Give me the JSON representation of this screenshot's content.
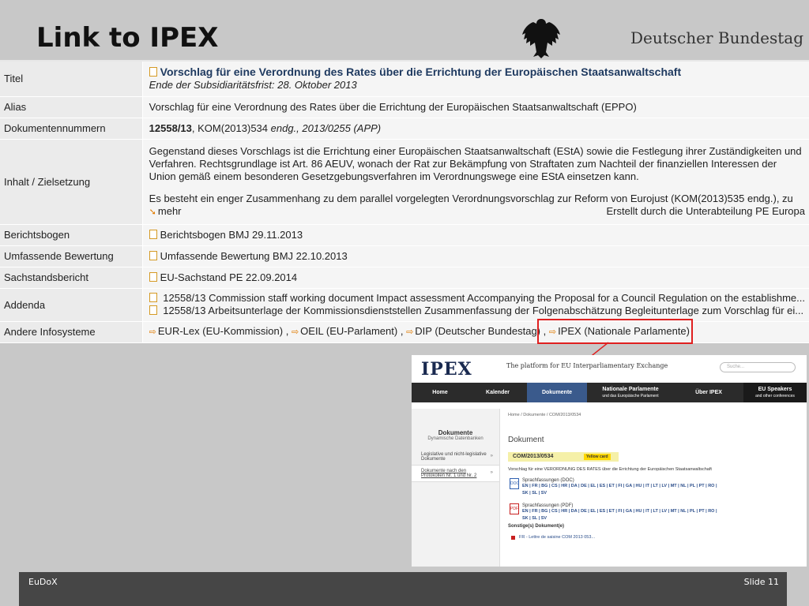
{
  "slide": {
    "title": "Link to IPEX",
    "org_name": "Deutscher Bundestag"
  },
  "rows": [
    {
      "label": "Titel",
      "title": "Vorschlag für eine Verordnung des Rates über die Errichtung der Europäischen Staatsanwaltschaft",
      "subtitle": "Ende der Subsidiaritätsfrist: 28. Oktober 2013"
    },
    {
      "label": "Alias",
      "value": "Vorschlag für eine Verordnung des Rates über die Errichtung der Europäischen Staatsanwaltschaft (EPPO)"
    },
    {
      "label": "Dokumentennummern",
      "bold": "12558/13",
      "rest1": ", KOM(2013)534 ",
      "ital": "endg.",
      "rest2": ", 2013/0255 (APP)"
    },
    {
      "label": "Inhalt / Zielsetzung",
      "para1": "Gegenstand dieses Vorschlags ist die Errichtung einer Europäischen Staatsanwaltschaft (EStA) sowie die Festlegung ihrer Zuständigkeiten und Verfahren. Rechtsgrundlage ist Art. 86 AEUV, wonach der Rat zur Bekämpfung von Straftaten zum Nachteil der finanziellen Interessen der Union gemäß einem besonderen Gesetzgebungsverfahren im Verordnungswege eine EStA einsetzen kann.",
      "para2": "Es besteht ein enger Zusammenhang zu dem parallel vorgelegten Verordnungsvorschlag zur Reform von Eurojust (KOM(2013)535 endg.), zu",
      "more": "mehr",
      "created_by": "Erstellt durch die Unterabteilung PE Europa"
    },
    {
      "label": "Berichtsbogen",
      "link": "Berichtsbogen BMJ 29.11.2013"
    },
    {
      "label": "Umfassende Bewertung",
      "link": "Umfassende Bewertung BMJ 22.10.2013"
    },
    {
      "label": "Sachstandsbericht",
      "link": "EU-Sachstand PE 22.09.2014"
    },
    {
      "label": "Addenda",
      "link1": "12558/13 Commission staff working document Impact assessment Accompanying the Proposal for a Council Regulation on the establishme...",
      "link2": "12558/13 Arbeitsunterlage der Kommissionsdienststellen Zusammenfassung der Folgenabschätzung Begleitunterlage zum Vorschlag für ei..."
    },
    {
      "label": "Andere Infosysteme",
      "links": [
        "EUR-Lex (EU-Kommission)",
        "OEIL (EU-Parlament)",
        "DIP (Deutscher Bundestag)",
        "IPEX (Nationale Parlamente)"
      ],
      "sep": " , "
    }
  ],
  "ipex": {
    "logo": "IPEX",
    "tagline": "The platform for EU Interparliamentary Exchange",
    "search_placeholder": "Suche...",
    "nav": [
      "Home",
      "Kalender",
      "Dokumente",
      "Nationale Parlamente",
      "und das Europäische Parlament",
      "Über IPEX",
      "EU Speakers",
      "and other conferences"
    ],
    "sidebar": {
      "title": "Dokumente",
      "subtitle": "Dynamische Datenbanken",
      "items": [
        "Legislative und nicht-legislative Dokumente",
        "Dokumente nach den Protokollen Nr. 1 und Nr. 2"
      ]
    },
    "breadcrumb": "Home / Dokumente / COM/2013/0534",
    "heading": "Dokument",
    "doc_code": "COM/2013/0534",
    "yellow_card": "Yellow card",
    "description": "Vorschlag für eine VERORDNUNG DES RATES über die Errichtung der Europäischen Staatsanwaltschaft",
    "doc_label": "Sprachfassungen (DOC)",
    "pdf_label": "Sprachfassungen (PDF)",
    "doc_icon": "DOC",
    "pdf_icon": "PDF",
    "langs_line1": "EN | FR | BG | CS | HR | DA | DE | EL | ES | ET | FI | GA | HU | IT | LT | LV | MT | NL | PL | PT | RO |",
    "langs_line2": "SK | SL | SV",
    "other_docs": "Sonstige(s) Dokument(e)",
    "fr_line": "FR - Lettre de saisine COM 2013 053..."
  },
  "footer": {
    "left": "EuDoX",
    "right": "Slide 11"
  },
  "colors": {
    "highlight": "#e02020",
    "link_icon": "#e07b00",
    "ipex_nav_bg": "#2b2b2b",
    "ipex_nav_active": "#3a5a8c"
  }
}
